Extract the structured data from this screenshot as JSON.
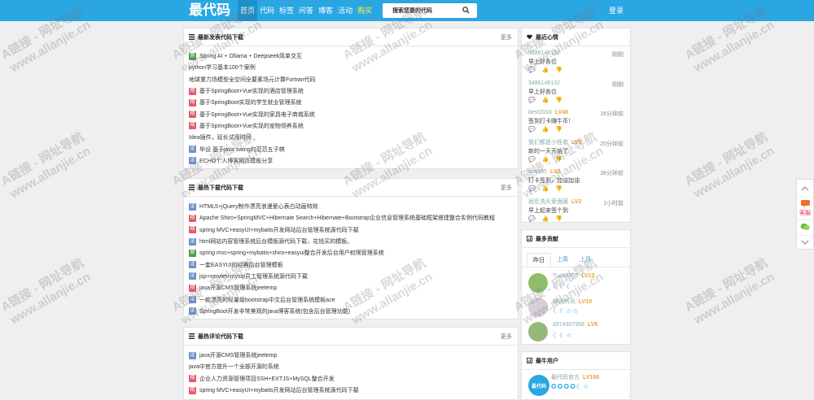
{
  "header": {
    "logo": "最代码",
    "nav": [
      "首页",
      "代码",
      "标签",
      "问答",
      "博客",
      "活动",
      "购买"
    ],
    "search_placeholder": "搜索您要的代码",
    "login": "登录"
  },
  "newest": {
    "title": "最新发表代码下载",
    "more": "更多",
    "items": [
      {
        "tag": "原",
        "text": "Spring AI + Ollama + Deepseek简单交互"
      },
      {
        "tag": "",
        "text": "python学习基本100个案例"
      },
      {
        "tag": "",
        "text": "地球重力场模型全空间全要素场元计算Fortran代码"
      },
      {
        "tag": "精",
        "text": "基于SpringBoot+Vue实现的酒店管理系统"
      },
      {
        "tag": "精",
        "text": "基于SpringBoot实现的学生就业管理系统"
      },
      {
        "tag": "精",
        "text": "基于SpringBoot+Vue实现的家具电子商城系统"
      },
      {
        "tag": "精",
        "text": "基于SpringBoot+Vue实现的宠物领养系统"
      },
      {
        "tag": "",
        "text": "Idea插件，延长试用时间"
      },
      {
        "tag": "证",
        "text": "毕设 基于java swing的范范五子棋"
      },
      {
        "tag": "证",
        "text": "ECHO个人博客网页模板分享"
      }
    ]
  },
  "hot": {
    "title": "最热下载代码下载",
    "more": "更多",
    "items": [
      {
        "tag": "证",
        "text": "HTML5+jQuery制作漂亮浪漫爱心表白动画特效"
      },
      {
        "tag": "精",
        "text": "Apache Shiro+SpringMVC+Hibernate Search+Hibernate+Bootstrap企业信息管理系统基础框架搭建整合实例代码教程"
      },
      {
        "tag": "精",
        "text": "spring MVC+easyUI+mybatis开发网站后台管理系统源代码下载"
      },
      {
        "tag": "证",
        "text": "html网站内容管理系统后台模板源代码下载，花钱买的模板。"
      },
      {
        "tag": "原",
        "text": "spring mvc+spring+mybatis+shiro+easyui整合开发后台用户权限管理系统"
      },
      {
        "tag": "证",
        "text": "一套EASYUI的经典后台管理模板"
      },
      {
        "tag": "证",
        "text": "jsp+servlet+mysql员工管理系统源代码下载"
      },
      {
        "tag": "精",
        "text": "java开源CMS管理系统jeetemp"
      },
      {
        "tag": "证",
        "text": "一款漂亮的轻量级bootstrap中文后台管理系统模板ace"
      },
      {
        "tag": "证",
        "text": "SpringBoot开发非常美观的java博客系统(包含后台管理功能)"
      }
    ]
  },
  "comment": {
    "title": "最热评论代码下载",
    "more": "更多",
    "items": [
      {
        "tag": "证",
        "text": "java开源CMS管理系统jeetemp"
      },
      {
        "tag": "",
        "text": "java中官方提升一个全部开源的系统"
      },
      {
        "tag": "精",
        "text": "企业人力资源管理项目SSH+EXTJS+MySQL整合开发"
      },
      {
        "tag": "精",
        "text": "spring MVC+easyUI+mybatis开发网站后台管理系统源代码下载"
      }
    ]
  },
  "feelings": {
    "title": "最近心情",
    "items": [
      {
        "name": "3486146132",
        "lv": "",
        "time": "刚刚",
        "msg": "早上好各位",
        "acts": "💬 👍 👎"
      },
      {
        "name": "3486146132",
        "lv": "",
        "time": "刚刚",
        "msg": "早上好各位",
        "acts": "💬 👍 👎"
      },
      {
        "name": "best2018",
        "lv": "LV46",
        "time": "16分钟前",
        "msg": "签到打卡赚牛币！",
        "acts": "💬 👍 👎"
      },
      {
        "name": "我们都是小怪兽",
        "lv": "LV3",
        "time": "20分钟前",
        "msg": "新的一天开始了",
        "acts": "💬 👍 👎"
      },
      {
        "name": "zhao31",
        "lv": "LV2",
        "time": "36分钟前",
        "msg": "打卡签到，加油加油",
        "acts": "💬 👍 👎"
      },
      {
        "name": "屈臣洗头爱面膜",
        "lv": "LV2",
        "time": "1小时前",
        "msg": "早上起来签个到",
        "acts": "💬 👍 👎"
      }
    ]
  },
  "contrib": {
    "title": "最多贡献",
    "tabs": [
      "昨日",
      "上周",
      "上月"
    ],
    "items": [
      {
        "name": "Tuan5555",
        "lv": "LV12",
        "moons": "☾☾☾"
      },
      {
        "name": "林间听风",
        "lv": "LV10",
        "moons": "☾☾☆☆"
      },
      {
        "name": "d374307958",
        "lv": "LV6",
        "moons": "☾☾☆"
      }
    ]
  },
  "toprich": {
    "title": "最牛用户",
    "items": [
      {
        "name": "最代码官方",
        "lv": "LV168",
        "badge": "最代码",
        "moons": "✪✪✪✪☾☆"
      }
    ]
  },
  "sidebar": {
    "service_label": "客服"
  },
  "watermark": {
    "line1": "A链接 - 网址导航",
    "line2": "www.allanjie.cn"
  },
  "colors": {
    "brand": "#2aa6e3",
    "tag_jing": "#e35a6d",
    "tag_zheng": "#6f8fc8",
    "tag_yuan": "#4e9a55",
    "level": "#e7a43a"
  }
}
